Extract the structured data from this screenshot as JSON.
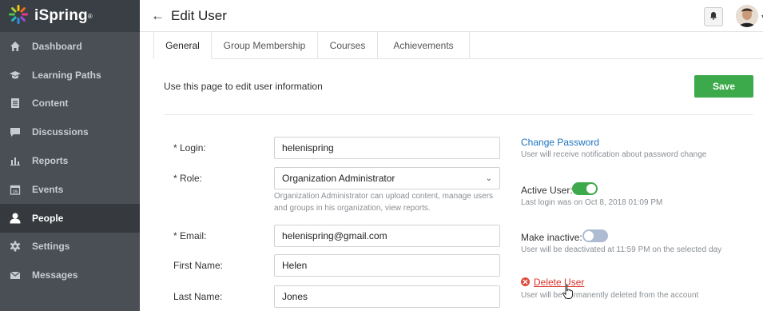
{
  "app": {
    "logo": "iSpring",
    "trademark": "®"
  },
  "sidebar": {
    "items": [
      {
        "label": "Dashboard",
        "icon": "home-icon",
        "active": false
      },
      {
        "label": "Learning Paths",
        "icon": "graduation-cap-icon",
        "active": false
      },
      {
        "label": "Content",
        "icon": "document-icon",
        "active": false
      },
      {
        "label": "Discussions",
        "icon": "chat-icon",
        "active": false
      },
      {
        "label": "Reports",
        "icon": "bar-chart-icon",
        "active": false
      },
      {
        "label": "Events",
        "icon": "calendar-icon",
        "active": false
      },
      {
        "label": "People",
        "icon": "person-icon",
        "active": true
      },
      {
        "label": "Settings",
        "icon": "gear-icon",
        "active": false
      },
      {
        "label": "Messages",
        "icon": "envelope-icon",
        "active": false
      }
    ],
    "events_icon_number": "15"
  },
  "header": {
    "back": "←",
    "title": "Edit User"
  },
  "tabs": [
    {
      "label": "General",
      "active": true
    },
    {
      "label": "Group Membership",
      "active": false
    },
    {
      "label": "Courses",
      "active": false
    },
    {
      "label": "Achievements",
      "active": false
    }
  ],
  "intro": "Use this page to edit user information",
  "save_label": "Save",
  "form": {
    "login_label": "* Login:",
    "login_value": "helenispring",
    "role_label": "* Role:",
    "role_value": "Organization Administrator",
    "role_hint": "Organization Administrator can upload content, manage users and groups in his organization, view reports.",
    "email_label": "* Email:",
    "email_value": "helenispring@gmail.com",
    "first_name_label": "First Name:",
    "first_name_value": "Helen",
    "last_name_label": "Last Name:",
    "last_name_value": "Jones"
  },
  "side": {
    "change_password": "Change Password",
    "change_password_note": "User will receive notification about password change",
    "active_user_label": "Active User:",
    "active_user_on": true,
    "last_login_note": "Last login was on Oct 8, 2018 01:09 PM",
    "make_inactive_label": "Make inactive:",
    "make_inactive_on": false,
    "deactivate_note": "User will be deactivated at 11:59 PM on the selected day",
    "delete_user": "Delete User",
    "delete_note": "User will be permanently deleted from the account"
  },
  "colors": {
    "accent_green": "#3ca94a",
    "link_blue": "#1e73be",
    "danger_red": "#d9342b",
    "sidebar_bg": "#4a4f55"
  }
}
